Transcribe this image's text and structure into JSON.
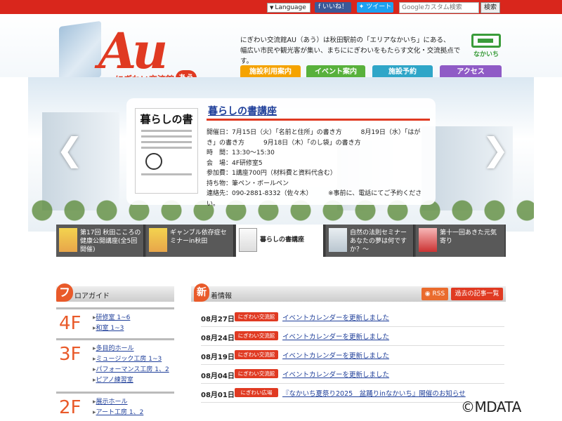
{
  "topbar": {
    "language_label": "Language",
    "like_label": "いいね！",
    "tweet_label": "ツイート",
    "search_placeholder": "Googleカスタム検索",
    "search_button": "検索"
  },
  "header": {
    "logo_mark": "Au",
    "logo_subtitle": "にぎわい交流館",
    "logo_badge": "あう",
    "intro_line1": "にぎわい交流館AU（あう）は秋田駅前の「エリアなかいち」にある、",
    "intro_line2": "幅広い市民や観光客が集い、まちににぎわいをもたらす文化・交流拠点です。",
    "partner_logo_text": "なかいち"
  },
  "nav": {
    "facility": "施設利用案内",
    "event": "イベント案内",
    "reserve": "施設予約",
    "access": "アクセス"
  },
  "featured": {
    "poster_title": "暮らしの書",
    "title": "暮らしの書講座",
    "details": [
      "開催日：7月15日（火）「名前と住所」の書き方　　　8月19日（水）「はが",
      "き」の書き方　　　9月18日（木）「のし袋」の書き方",
      "時　間：13:30～15:30",
      "会　場：4F研修室5",
      "参加費：1講座700円（材料費と資料代含む）",
      "持ち物：筆ペン・ボールペン",
      "連絡先：090-2881-8332（佐々木）　　　※事前に、電話にてご予約くださ",
      "い。"
    ]
  },
  "thumbnails": [
    {
      "label": "第17回 秋田こころの健康公開講座(全5回開催)"
    },
    {
      "label": "ギャンブル依存症セミナーin秋田"
    },
    {
      "label": "暮らしの書講座"
    },
    {
      "label": "自然の法則セミナー あなたの夢は何ですか？～"
    },
    {
      "label": "第十一回あきた元気寄り"
    }
  ],
  "floor_guide": {
    "title": "ロアガイド",
    "bubble": "フ",
    "floors": [
      {
        "num": "4F",
        "rooms": [
          "研修室 1~6",
          "和室 1~3"
        ]
      },
      {
        "num": "3F",
        "rooms": [
          "多目的ホール",
          "ミュージック工房 1~3",
          "パフォーマンス工房 1、2",
          "ピアノ練習室"
        ]
      },
      {
        "num": "2F",
        "rooms": [
          "展示ホール",
          "アート工房 1、2"
        ]
      }
    ]
  },
  "news": {
    "bubble": "新",
    "title": "着情報",
    "rss_label": "RSS",
    "archive_label": "過去の記事一覧",
    "items": [
      {
        "date": "08月27日",
        "category": "にぎわい交流館",
        "text": "イベントカレンダーを更新しました"
      },
      {
        "date": "08月24日",
        "category": "にぎわい交流館",
        "text": "イベントカレンダーを更新しました"
      },
      {
        "date": "08月19日",
        "category": "にぎわい交流館",
        "text": "イベントカレンダーを更新しました"
      },
      {
        "date": "08月04日",
        "category": "にぎわい交流館",
        "text": "イベントカレンダーを更新しました"
      },
      {
        "date": "08月01日",
        "category": "にぎわい広場",
        "text": "『なかいち夏祭り2025　盆踊りinなかいち』開催のお知らせ"
      }
    ]
  },
  "watermark": "©MDATA",
  "colors": {
    "brand_red": "#e03a22",
    "floor_orange": "#e95a2a",
    "nav_facility": "#f5a300",
    "nav_event": "#58b13c",
    "nav_reserve": "#2fa6c8",
    "nav_access": "#8f5bc6",
    "link_blue": "#1f3f9a"
  }
}
